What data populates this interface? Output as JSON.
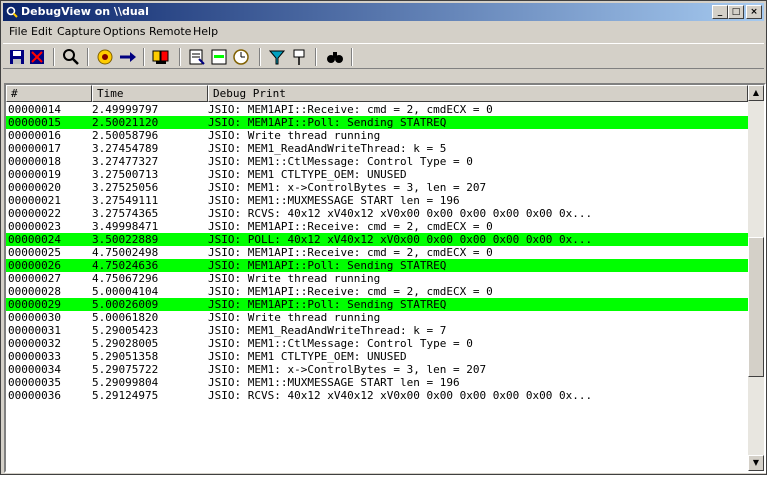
{
  "window": {
    "title": "DebugView on \\\\dual",
    "controls": {
      "minimize": "_",
      "maximize": "□",
      "close": "×"
    }
  },
  "menu": [
    {
      "label": "File"
    },
    {
      "label": "Edit"
    },
    {
      "label": "Capture"
    },
    {
      "label": "Options"
    },
    {
      "label": "Remote"
    },
    {
      "label": "Help"
    }
  ],
  "toolbar": {
    "icons": [
      "save-icon",
      "clear-display-icon",
      "find-icon",
      "capture-icon",
      "autoscroll-icon",
      "time-icon",
      "filter-icon",
      "highlight-icon",
      "clock-icon",
      "funnel-icon",
      "pin-icon",
      "binoculars-icon"
    ]
  },
  "columns": [
    "#",
    "Time",
    "Debug Print"
  ],
  "rows": [
    {
      "num": "00000014",
      "time": "2.49999797",
      "text": "JSIO: MEM1API::Receive: cmd = 2, cmdECX = 0",
      "hl": false
    },
    {
      "num": "00000015",
      "time": "2.50021120",
      "text": "JSIO: MEM1API::Poll: Sending STATREQ",
      "hl": true
    },
    {
      "num": "00000016",
      "time": "2.50058796",
      "text": "JSIO: Write thread running",
      "hl": false
    },
    {
      "num": "00000017",
      "time": "3.27454789",
      "text": "JSIO: MEM1_ReadAndWriteThread: k = 5",
      "hl": false
    },
    {
      "num": "00000018",
      "time": "3.27477327",
      "text": "JSIO: MEM1::CtlMessage: Control Type = 0",
      "hl": false
    },
    {
      "num": "00000019",
      "time": "3.27500713",
      "text": "JSIO: MEM1 CTLTYPE_OEM: UNUSED",
      "hl": false
    },
    {
      "num": "00000020",
      "time": "3.27525056",
      "text": "JSIO: MEM1: x->ControlBytes = 3, len = 207",
      "hl": false
    },
    {
      "num": "00000021",
      "time": "3.27549111",
      "text": "JSIO: MEM1::MUXMESSAGE START len = 196",
      "hl": false
    },
    {
      "num": "00000022",
      "time": "3.27574365",
      "text": "JSIO: RCVS: 40x12 xV40x12 xV0x00 0x00 0x00 0x00 0x00 0x...",
      "hl": false
    },
    {
      "num": "00000023",
      "time": "3.49998471",
      "text": "JSIO: MEM1API::Receive: cmd = 2, cmdECX = 0",
      "hl": false
    },
    {
      "num": "00000024",
      "time": "3.50022889",
      "text": "JSIO: POLL: 40x12 xV40x12 xV0x00 0x00 0x00 0x00 0x00 0x...",
      "hl": true
    },
    {
      "num": "00000025",
      "time": "4.75002498",
      "text": "JSIO: MEM1API::Receive: cmd = 2, cmdECX = 0",
      "hl": false
    },
    {
      "num": "00000026",
      "time": "4.75024636",
      "text": "JSIO: MEM1API::Poll: Sending STATREQ",
      "hl": true
    },
    {
      "num": "00000027",
      "time": "4.75067296",
      "text": "JSIO: Write thread running",
      "hl": false
    },
    {
      "num": "00000028",
      "time": "5.00004104",
      "text": "JSIO: MEM1API::Receive: cmd = 2, cmdECX = 0",
      "hl": false
    },
    {
      "num": "00000029",
      "time": "5.00026009",
      "text": "JSIO: MEM1API::Poll: Sending STATREQ",
      "hl": true
    },
    {
      "num": "00000030",
      "time": "5.00061820",
      "text": "JSIO: Write thread running",
      "hl": false
    },
    {
      "num": "00000031",
      "time": "5.29005423",
      "text": "JSIO: MEM1_ReadAndWriteThread: k = 7",
      "hl": false
    },
    {
      "num": "00000032",
      "time": "5.29028005",
      "text": "JSIO: MEM1::CtlMessage: Control Type = 0",
      "hl": false
    },
    {
      "num": "00000033",
      "time": "5.29051358",
      "text": "JSIO: MEM1 CTLTYPE_OEM: UNUSED",
      "hl": false
    },
    {
      "num": "00000034",
      "time": "5.29075722",
      "text": "JSIO: MEM1: x->ControlBytes = 3, len = 207",
      "hl": false
    },
    {
      "num": "00000035",
      "time": "5.29099804",
      "text": "JSIO: MEM1::MUXMESSAGE START len = 196",
      "hl": false
    },
    {
      "num": "00000036",
      "time": "5.29124975",
      "text": "JSIO: RCVS: 40x12 xV40x12 xV0x00 0x00 0x00 0x00 0x00 0x...",
      "hl": false
    }
  ],
  "colors": {
    "highlight": "#00ff00",
    "titlebar": "#0a246a"
  }
}
